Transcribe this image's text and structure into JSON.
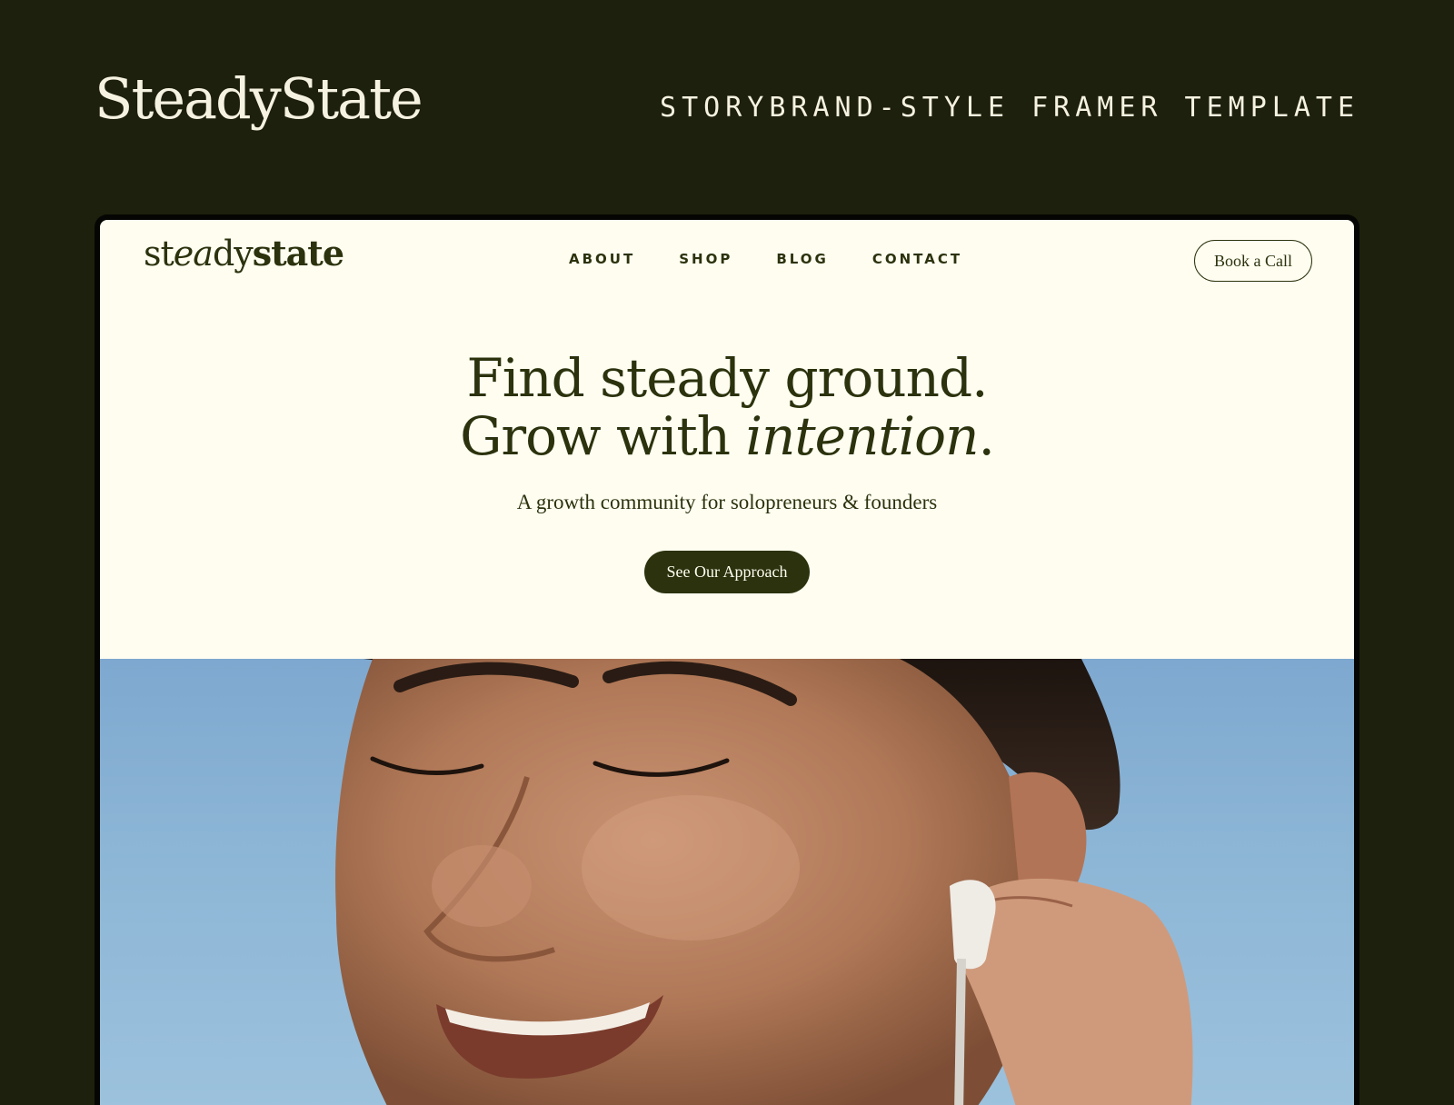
{
  "outer": {
    "brand": "SteadyState",
    "tagline": "STORYBRAND-STYLE FRAMER TEMPLATE"
  },
  "site": {
    "logo": {
      "part1": "st",
      "part2": "ea",
      "part3": "dy",
      "part4": "state"
    },
    "nav": [
      {
        "label": "ABOUT"
      },
      {
        "label": "SHOP"
      },
      {
        "label": "BLOG"
      },
      {
        "label": "CONTACT"
      }
    ],
    "book_call_label": "Book a Call"
  },
  "hero": {
    "headline_line1": "Find steady ground.",
    "headline_line2_prefix": "Grow with ",
    "headline_line2_italic": "intention",
    "headline_line2_suffix": ".",
    "subheadline": "A growth community for solopreneurs & founders",
    "cta_label": "See Our Approach"
  },
  "colors": {
    "page_background": "#1d200c",
    "site_background": "#fffdf0",
    "brand_green": "#2b320d",
    "sky_blue": "#8db6d6"
  },
  "image": {
    "icon": "hero-photo-smiling-woman-with-earbud"
  }
}
